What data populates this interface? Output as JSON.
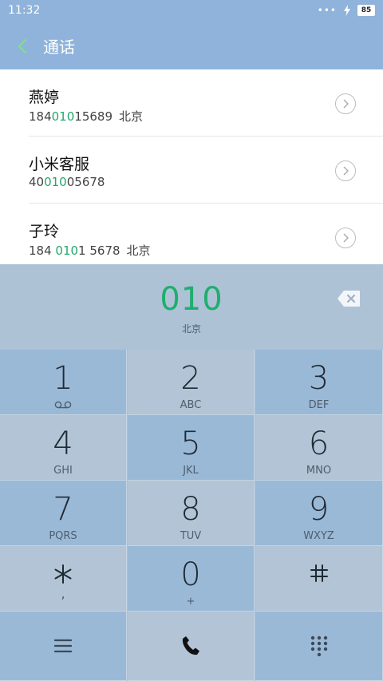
{
  "status": {
    "time": "11:32",
    "battery": "85"
  },
  "header": {
    "title": "通话"
  },
  "contacts": [
    {
      "name": "燕婷",
      "pre": "184",
      "match": "010",
      "post": "15689",
      "location": "北京"
    },
    {
      "name": "小米客服",
      "pre": "40",
      "match": "010",
      "post": "05678",
      "location": ""
    },
    {
      "name": "子玲",
      "pre": "184 ",
      "match": "010",
      "post": "1 5678",
      "location": "北京"
    }
  ],
  "dialer": {
    "number": "010",
    "region": "北京"
  },
  "keys": [
    {
      "digit": "1",
      "letters": "",
      "icon": "voicemail-icon"
    },
    {
      "digit": "2",
      "letters": "ABC"
    },
    {
      "digit": "3",
      "letters": "DEF"
    },
    {
      "digit": "4",
      "letters": "GHI"
    },
    {
      "digit": "5",
      "letters": "JKL"
    },
    {
      "digit": "6",
      "letters": "MNO"
    },
    {
      "digit": "7",
      "letters": "PQRS"
    },
    {
      "digit": "8",
      "letters": "TUV"
    },
    {
      "digit": "9",
      "letters": "WXYZ"
    },
    {
      "digit": "*",
      "letters": ","
    },
    {
      "digit": "0",
      "letters": "+"
    },
    {
      "digit": "#",
      "letters": ""
    }
  ],
  "colors": {
    "accent": "#22a86a",
    "header": "#8fb3da"
  }
}
